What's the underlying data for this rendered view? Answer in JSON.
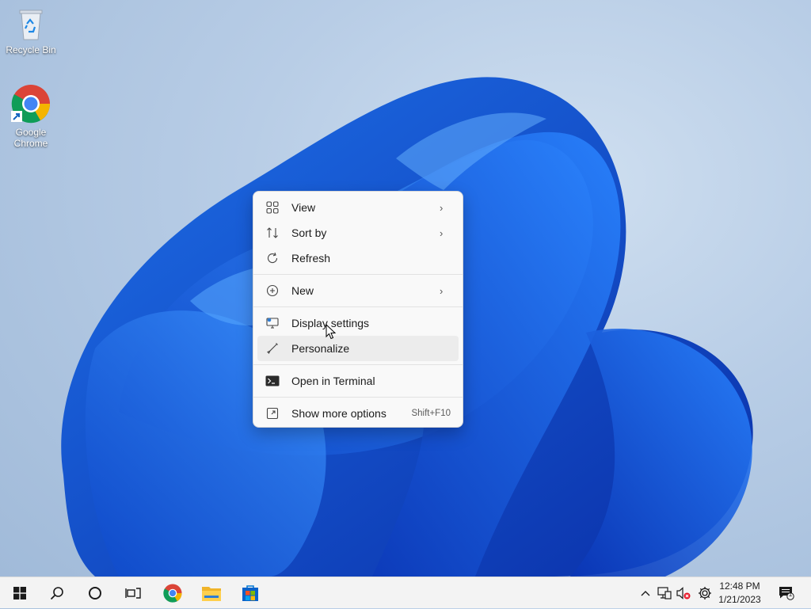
{
  "desktop": {
    "icons": [
      {
        "label": "Recycle Bin"
      },
      {
        "label": "Google Chrome"
      }
    ]
  },
  "context_menu": {
    "items": [
      {
        "label": "View",
        "icon": "view-grid-icon",
        "submenu": true
      },
      {
        "label": "Sort by",
        "icon": "sort-icon",
        "submenu": true
      },
      {
        "label": "Refresh",
        "icon": "refresh-icon"
      },
      {
        "label": "New",
        "icon": "new-plus-icon",
        "submenu": true
      },
      {
        "label": "Display settings",
        "icon": "display-icon"
      },
      {
        "label": "Personalize",
        "icon": "brush-icon"
      },
      {
        "label": "Open in Terminal",
        "icon": "terminal-icon"
      },
      {
        "label": "Show more options",
        "icon": "more-options-icon",
        "shortcut": "Shift+F10"
      }
    ],
    "hovered": "Personalize"
  },
  "taskbar": {
    "apps": [
      "start-icon",
      "search-icon",
      "cortana-icon",
      "task-view-icon",
      "chrome-icon",
      "file-explorer-icon",
      "store-icon"
    ],
    "tray": [
      "chevron-up-icon",
      "network-icon",
      "volume-muted-icon",
      "settings-gear-icon",
      "notifications-icon"
    ],
    "time": "12:48 PM",
    "date": "1/21/2023",
    "notification_count": "1"
  },
  "colors": {
    "accent": "#0078d4",
    "menu_bg": "#f9f9f9",
    "taskbar_bg": "#f3f3f3"
  }
}
